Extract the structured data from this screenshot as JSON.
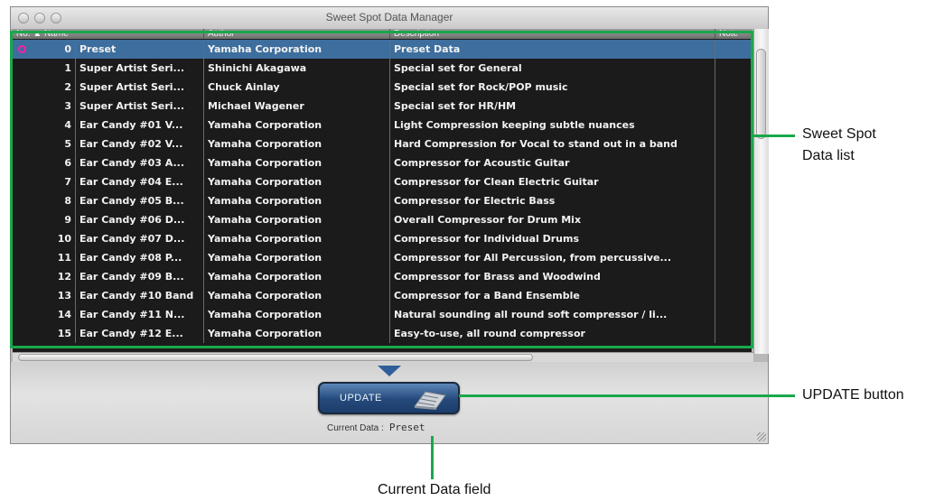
{
  "window": {
    "title": "Sweet Spot Data Manager"
  },
  "table": {
    "columns": [
      "No. ▲ Name",
      "Author",
      "Description",
      "Note"
    ],
    "rows": [
      {
        "no": "0",
        "name": "Preset",
        "author": "Yamaha Corporation",
        "description": "Preset Data",
        "note": ""
      },
      {
        "no": "1",
        "name": "Super Artist Seri...",
        "author": "Shinichi Akagawa",
        "description": "Special set for General",
        "note": ""
      },
      {
        "no": "2",
        "name": "Super Artist Seri...",
        "author": "Chuck Ainlay",
        "description": "Special set for Rock/POP music",
        "note": ""
      },
      {
        "no": "3",
        "name": "Super Artist Seri...",
        "author": "Michael Wagener",
        "description": "Special set for HR/HM",
        "note": ""
      },
      {
        "no": "4",
        "name": "Ear Candy #01 V...",
        "author": "Yamaha Corporation",
        "description": "Light Compression keeping subtle nuances",
        "note": ""
      },
      {
        "no": "5",
        "name": "Ear Candy #02 V...",
        "author": "Yamaha Corporation",
        "description": "Hard Compression for Vocal to stand out in a band",
        "note": ""
      },
      {
        "no": "6",
        "name": "Ear Candy #03 A...",
        "author": "Yamaha Corporation",
        "description": "Compressor for Acoustic Guitar",
        "note": ""
      },
      {
        "no": "7",
        "name": "Ear Candy #04 E...",
        "author": "Yamaha Corporation",
        "description": "Compressor for Clean Electric Guitar",
        "note": ""
      },
      {
        "no": "8",
        "name": "Ear Candy #05 B...",
        "author": "Yamaha Corporation",
        "description": "Compressor for Electric Bass",
        "note": ""
      },
      {
        "no": "9",
        "name": "Ear Candy #06 D...",
        "author": "Yamaha Corporation",
        "description": "Overall Compressor for Drum Mix",
        "note": ""
      },
      {
        "no": "10",
        "name": "Ear Candy #07 D...",
        "author": "Yamaha Corporation",
        "description": "Compressor for Individual Drums",
        "note": ""
      },
      {
        "no": "11",
        "name": "Ear Candy #08 P...",
        "author": "Yamaha Corporation",
        "description": "Compressor for All Percussion, from percussive...",
        "note": ""
      },
      {
        "no": "12",
        "name": "Ear Candy #09 B...",
        "author": "Yamaha Corporation",
        "description": "Compressor for Brass and Woodwind",
        "note": ""
      },
      {
        "no": "13",
        "name": "Ear Candy #10 Band",
        "author": "Yamaha Corporation",
        "description": "Compressor for a Band Ensemble",
        "note": ""
      },
      {
        "no": "14",
        "name": "Ear Candy #11 N...",
        "author": "Yamaha Corporation",
        "description": "Natural sounding all round soft compressor / li...",
        "note": ""
      },
      {
        "no": "15",
        "name": "Ear Candy #12 E...",
        "author": "Yamaha Corporation",
        "description": "Easy-to-use, all round compressor",
        "note": ""
      }
    ],
    "selected_index": 0
  },
  "update_button": {
    "label": "UPDATE"
  },
  "current_data": {
    "label": "Current Data :",
    "value": "Preset"
  },
  "callouts": {
    "list": "Sweet Spot\nData list",
    "update": "UPDATE button",
    "current": "Current Data field"
  },
  "colors": {
    "callout_green": "#19a84a",
    "selected_row": "#3d6e9e",
    "table_bg": "#1b1b1b"
  }
}
